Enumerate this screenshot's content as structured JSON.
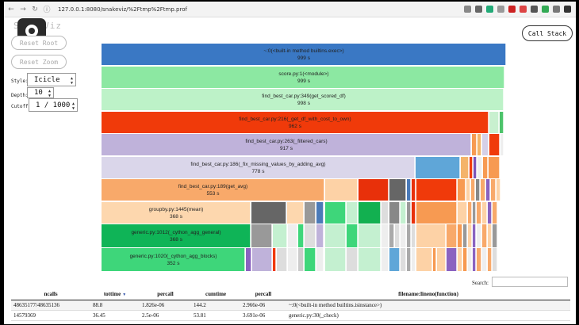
{
  "browser": {
    "url": "127.0.0.1:8080/snakeviz/%2Ftmp%2Ftmp.prof"
  },
  "app": {
    "title": "SnakeViz",
    "call_stack_button": "Call Stack",
    "reset_root_button": "Reset Root",
    "reset_zoom_button": "Reset Zoom",
    "style_label": "Style:",
    "style_value": "Icicle",
    "depth_label": "Depth:",
    "depth_value": "10",
    "cutoff_label": "Cutoff:",
    "cutoff_value": "1 / 1000"
  },
  "flame_labels": [
    {
      "name": "~:0(<built-in method builtins.exec>)",
      "time": "999 s"
    },
    {
      "name": "score.py:1(<module>)",
      "time": "999 s"
    },
    {
      "name": "find_best_car.py:349(get_scored_df)",
      "time": "998 s"
    },
    {
      "name": "find_best_car.py:216(_get_df_with_cost_to_own)",
      "time": "962 s"
    },
    {
      "name": "find_best_car.py:263(_filtered_cars)",
      "time": "917 s"
    },
    {
      "name": "find_best_car.py:186(_fix_missing_values_by_adding_avg)",
      "time": "778 s"
    },
    {
      "name": "find_best_car.py:189(get_avg)",
      "time": "553 s"
    },
    {
      "name": "groupby.py:1445(mean)",
      "time": "368 s"
    },
    {
      "name": "generic.py:1012(_cython_agg_general)",
      "time": "368 s"
    },
    {
      "name": "generic.py:1020(_cython_agg_blocks)",
      "time": "352 s"
    }
  ],
  "search": {
    "label": "Search:",
    "value": ""
  },
  "table": {
    "headers": [
      "ncalls",
      "tottime",
      "percall",
      "cumtime",
      "percall",
      "filename:lineno(function)"
    ],
    "rows": [
      [
        "48635177/48635136",
        "88.8",
        "1.826e-06",
        "144.2",
        "2.966e-06",
        "~:0(<built-in method builtins.isinstance>)"
      ],
      [
        "14579369",
        "36.45",
        "2.5e-06",
        "53.81",
        "3.691e-06",
        "generic.py:30(_check)"
      ]
    ]
  }
}
